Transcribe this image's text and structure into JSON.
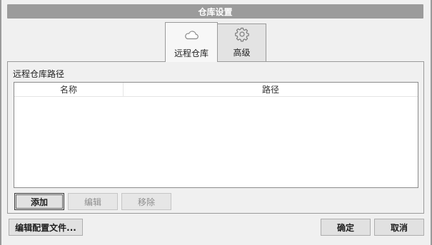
{
  "window": {
    "title": "仓库设置"
  },
  "tabs": [
    {
      "label": "远程仓库",
      "icon": "cloud-icon",
      "active": true
    },
    {
      "label": "高级",
      "icon": "gear-icon",
      "active": false
    }
  ],
  "panel": {
    "title": "远程仓库路径",
    "columns": [
      "名称",
      "路径"
    ],
    "rows": []
  },
  "list_buttons": {
    "add": "添加",
    "edit": "编辑",
    "remove": "移除"
  },
  "footer": {
    "edit_config": "编辑配置文件...",
    "ok": "确定",
    "cancel": "取消"
  }
}
